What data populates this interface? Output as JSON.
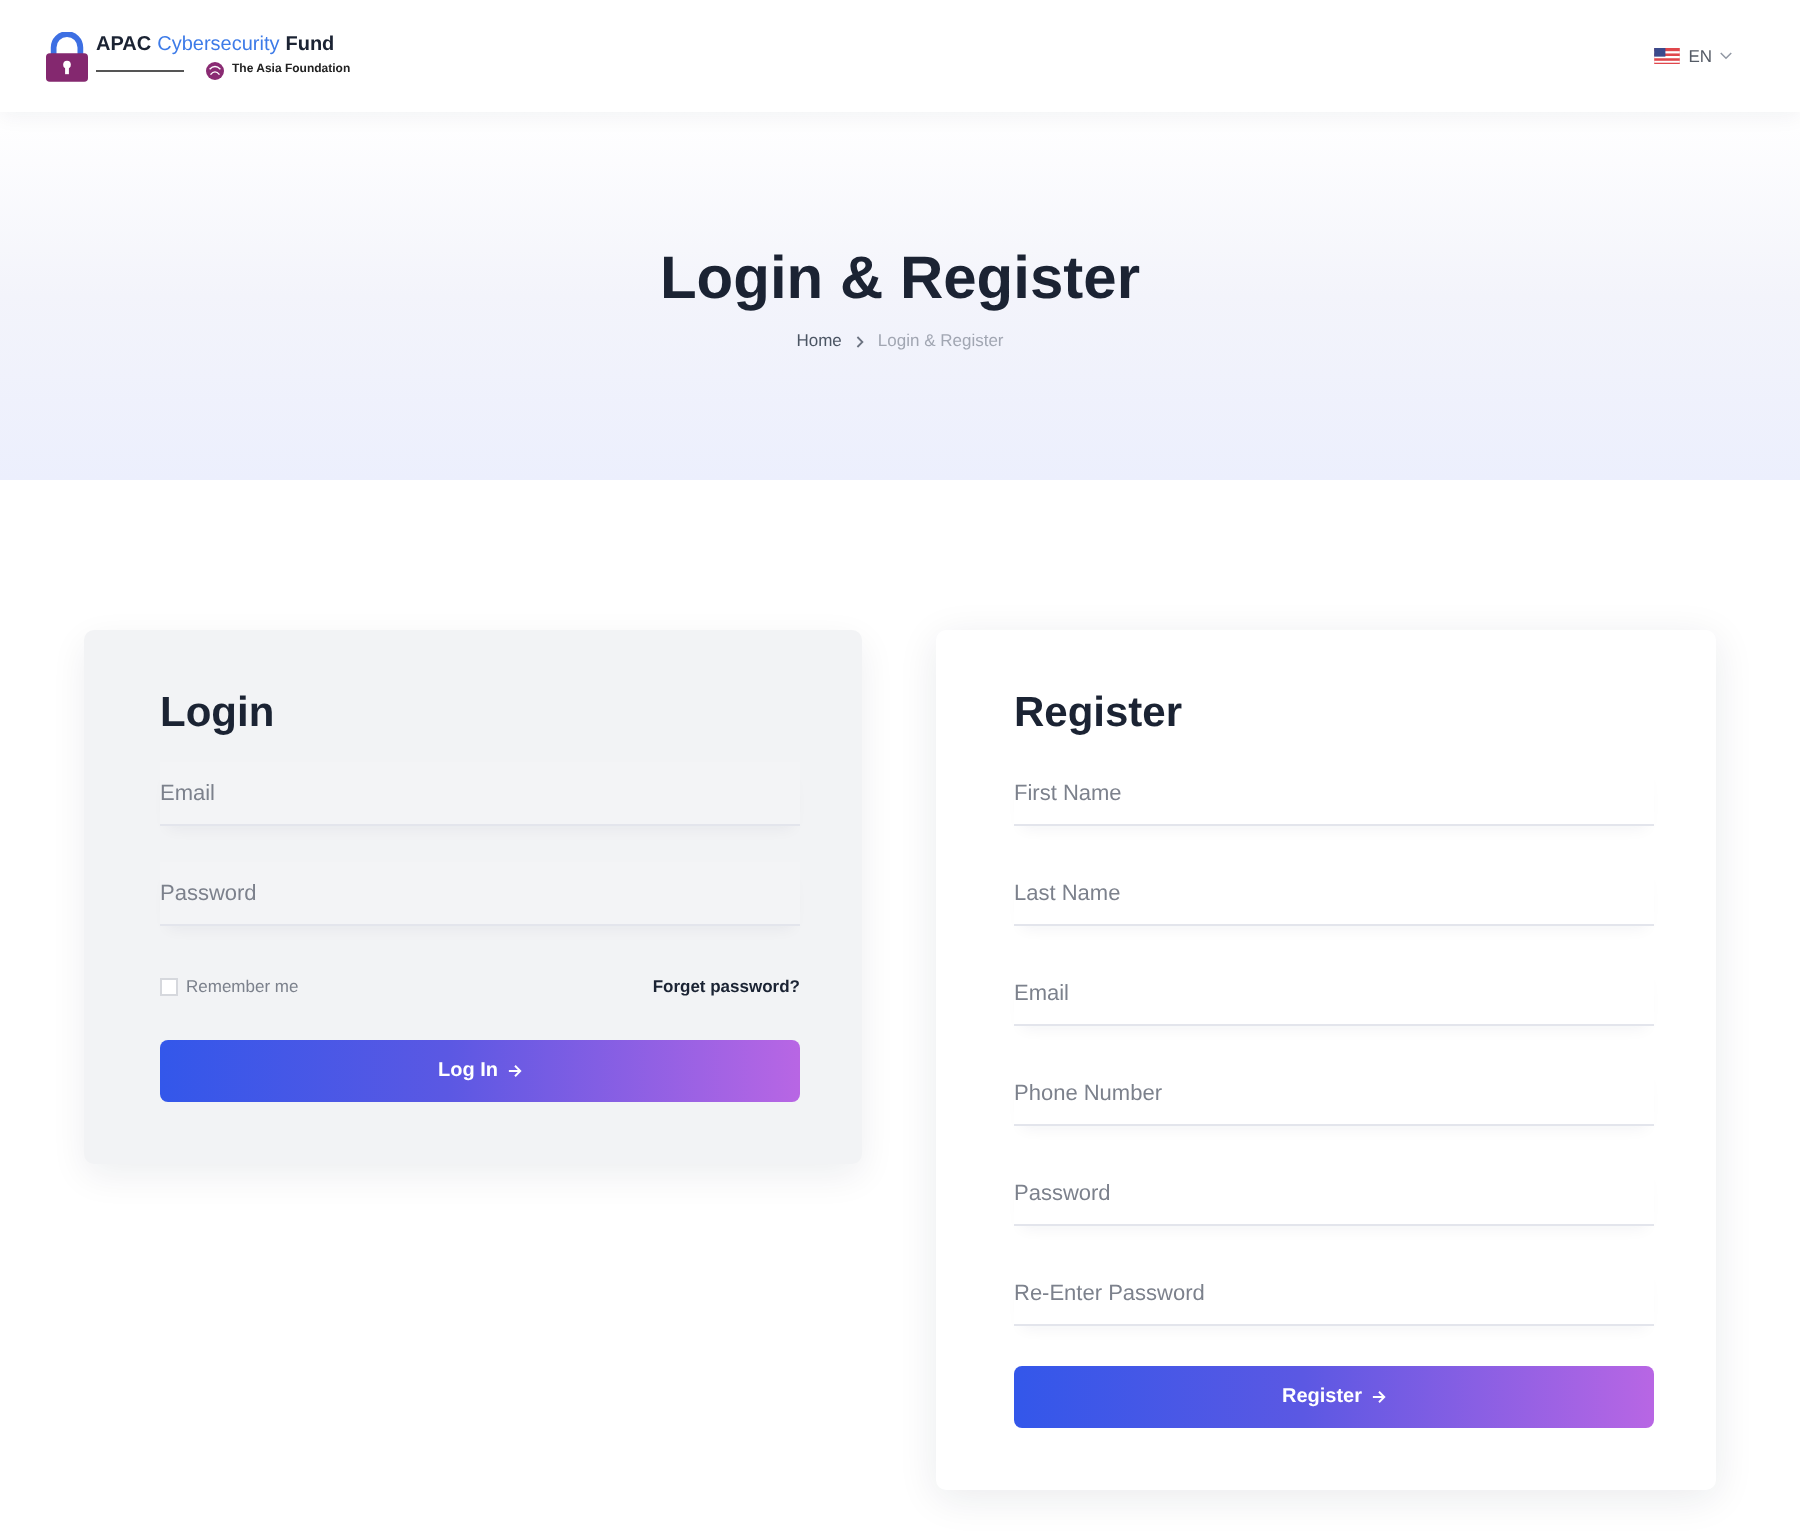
{
  "header": {
    "logo": {
      "title_parts": [
        {
          "text": "APAC",
          "highlight": false
        },
        {
          "text": "Cybersecurity",
          "highlight": true
        },
        {
          "text": "Fund",
          "highlight": false
        }
      ],
      "subtitle": "The Asia Foundation"
    },
    "language": {
      "code": "EN"
    }
  },
  "hero": {
    "title": "Login & Register",
    "breadcrumb": [
      {
        "label": "Home",
        "current": false
      },
      {
        "label": "Login & Register",
        "current": true
      }
    ]
  },
  "login": {
    "title": "Login",
    "fields": [
      {
        "placeholder": "Email"
      },
      {
        "placeholder": "Password"
      }
    ],
    "remember": {
      "label": "Remember me",
      "checked": false
    },
    "forgot_link": "Forget password?",
    "button": "Log In"
  },
  "register": {
    "title": "Register",
    "fields": [
      {
        "placeholder": "First Name"
      },
      {
        "placeholder": "Last Name"
      },
      {
        "placeholder": "Email"
      },
      {
        "placeholder": "Phone Number"
      },
      {
        "placeholder": "Password"
      },
      {
        "placeholder": "Re-Enter Password"
      }
    ],
    "button": "Register"
  }
}
